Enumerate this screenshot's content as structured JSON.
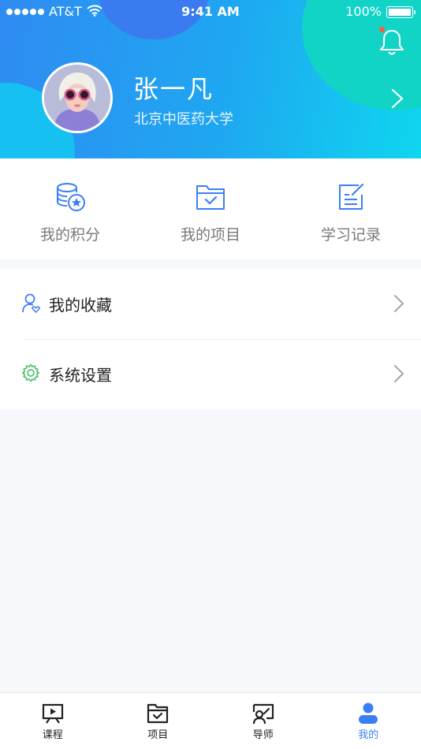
{
  "status_bar": {
    "carrier": "AT&T",
    "time": "9:41 AM",
    "battery": "100%"
  },
  "profile": {
    "name": "张一凡",
    "school": "北京中医药大学"
  },
  "quick_links": [
    {
      "label": "我的积分",
      "icon": "coins-star-icon"
    },
    {
      "label": "我的项目",
      "icon": "folder-check-icon"
    },
    {
      "label": "学习记录",
      "icon": "note-edit-icon"
    }
  ],
  "menu": [
    {
      "label": "我的收藏",
      "icon": "user-heart-icon"
    },
    {
      "label": "系统设置",
      "icon": "gear-icon"
    }
  ],
  "tabs": [
    {
      "label": "课程",
      "icon": "video-board-icon"
    },
    {
      "label": "项目",
      "icon": "folder-check-icon"
    },
    {
      "label": "导师",
      "icon": "mentor-icon"
    },
    {
      "label": "我的",
      "icon": "person-icon"
    }
  ],
  "colors": {
    "accent": "#3a7ff6",
    "header_start": "#2f8bf2",
    "header_end": "#0fd6ef",
    "settings_green": "#4cc36b",
    "notification_dot": "#ff5a3c"
  }
}
